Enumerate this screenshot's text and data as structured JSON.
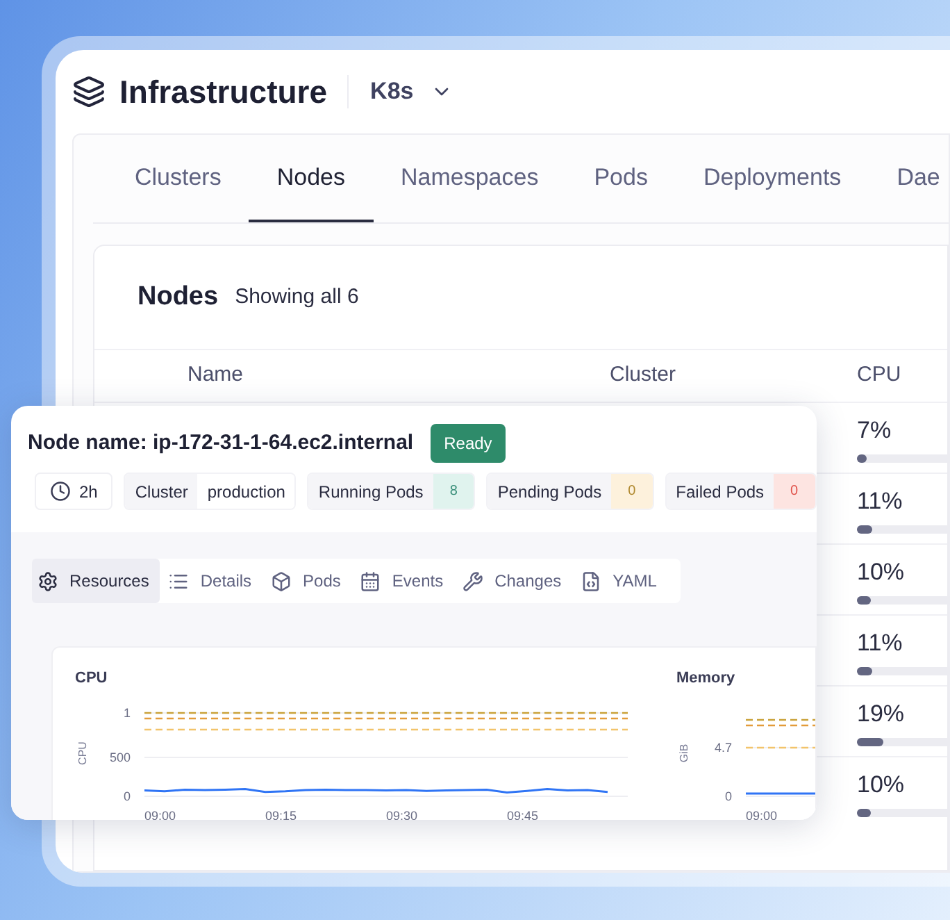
{
  "app": {
    "title": "Infrastructure",
    "context": "K8s"
  },
  "tabs": [
    {
      "label": "Clusters",
      "selected": false
    },
    {
      "label": "Nodes",
      "selected": true
    },
    {
      "label": "Namespaces",
      "selected": false
    },
    {
      "label": "Pods",
      "selected": false
    },
    {
      "label": "Deployments",
      "selected": false
    },
    {
      "label": "Dae",
      "selected": false
    }
  ],
  "nodes_card": {
    "title": "Nodes",
    "subtitle": "Showing all 6",
    "columns": [
      "Name",
      "Cluster",
      "CPU"
    ],
    "rows": [
      {
        "cpu": "7%",
        "level": 0.07
      },
      {
        "cpu": "11%",
        "level": 0.11
      },
      {
        "cpu": "10%",
        "level": 0.1
      },
      {
        "cpu": "11%",
        "level": 0.11
      },
      {
        "cpu": "19%",
        "level": 0.19
      },
      {
        "cpu": "10%",
        "level": 0.1
      }
    ]
  },
  "node_panel": {
    "title": "Node name: ip-172-31-1-64.ec2.internal",
    "status": "Ready",
    "age": "2h",
    "chips": [
      {
        "label": "Cluster",
        "value": "production",
        "kind": "plain"
      },
      {
        "label": "Running Pods",
        "value": "8",
        "kind": "success"
      },
      {
        "label": "Pending Pods",
        "value": "0",
        "kind": "warning"
      },
      {
        "label": "Failed Pods",
        "value": "0",
        "kind": "danger"
      }
    ],
    "tabs": [
      {
        "label": "Resources",
        "selected": true
      },
      {
        "label": "Details",
        "selected": false
      },
      {
        "label": "Pods",
        "selected": false
      },
      {
        "label": "Events",
        "selected": false
      },
      {
        "label": "Changes",
        "selected": false
      },
      {
        "label": "YAML",
        "selected": false
      }
    ],
    "charts": [
      {
        "title": "CPU",
        "axis_title": "CPU",
        "y_labels": [
          "1",
          "500",
          "0"
        ],
        "x_labels": [
          "09:00",
          "09:15",
          "09:30",
          "09:45"
        ]
      },
      {
        "title": "Memory",
        "axis_title": "GiB",
        "y_labels": [
          "4.7",
          "0"
        ],
        "x_labels": [
          "09:00"
        ]
      }
    ]
  }
}
